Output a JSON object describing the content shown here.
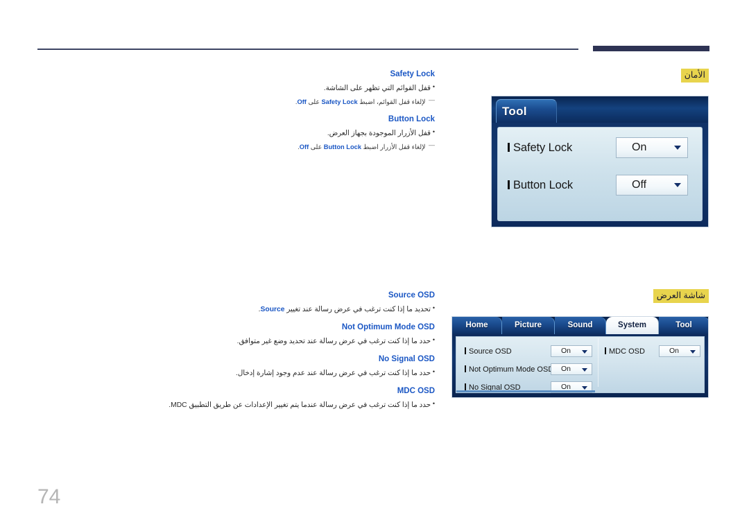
{
  "page": {
    "number": "74"
  },
  "header": {
    "rule_color": "#3c4463",
    "accent_bar_color": "#2e3354"
  },
  "sections": [
    {
      "tag": "الأمان",
      "tag_highlight_color": "#e8d44d",
      "entries": [
        {
          "heading": "Safety Lock",
          "bullet_prefix": "•",
          "bullet": "قفل القوائم التي تظهر على الشاشة.",
          "note_dash": "—",
          "note_ar_before": "لإلغاء قفل القوائم، اضبط",
          "note_en": "Safety Lock",
          "note_ar_mid": "على",
          "note_en_2": "Off",
          "note_ar_after": "."
        },
        {
          "heading": "Button Lock",
          "bullet_prefix": "•",
          "bullet": "قفل الأزرار الموجودة بجهاز العرض.",
          "note_dash": "—",
          "note_ar_before": "لإلغاء قفل الأزرار اضبط",
          "note_en": "Button Lock",
          "note_ar_mid": "على",
          "note_en_2": "Off",
          "note_ar_after": "."
        }
      ]
    },
    {
      "tag": "شاشة العرض",
      "tag_highlight_color": "#e8d44d",
      "entries": [
        {
          "heading": "Source OSD",
          "bullet_prefix": "•",
          "bullet_ar_before": "تحديد ما إذا كنت ترغب في عرض رسالة عند تغيير",
          "bullet_en": "Source",
          "bullet_ar_after": "."
        },
        {
          "heading": "Not Optimum Mode OSD",
          "bullet_prefix": "•",
          "bullet": "حدد ما إذا كنت ترغب في عرض رسالة عند تحديد وضع غير متوافق."
        },
        {
          "heading": "No Signal OSD",
          "bullet_prefix": "•",
          "bullet": "حدد ما إذا كنت ترغب في عرض رسالة عند عدم وجود إشارة إدخال."
        },
        {
          "heading": "MDC OSD",
          "bullet_prefix": "•",
          "bullet_ar_before": "حدد ما إذا كنت ترغب في عرض رسالة عندما يتم تغيير الإعدادات عن طريق التطبيق",
          "bullet_en": "MDC",
          "bullet_ar_after": "."
        }
      ]
    }
  ],
  "osd_tool": {
    "tab_label": "Tool",
    "rows": [
      {
        "label": "Safety Lock",
        "value": "On"
      },
      {
        "label": "Button Lock",
        "value": "Off"
      }
    ]
  },
  "osd_system": {
    "tabs": [
      {
        "label": "Home",
        "active": false
      },
      {
        "label": "Picture",
        "active": false
      },
      {
        "label": "Sound",
        "active": false
      },
      {
        "label": "System",
        "active": true
      },
      {
        "label": "Tool",
        "active": false
      }
    ],
    "left_rows": [
      {
        "label": "Source OSD",
        "value": "On"
      },
      {
        "label": "Not Optimum Mode OSD",
        "value": "On"
      },
      {
        "label": "No Signal OSD",
        "value": "On"
      }
    ],
    "right_rows": [
      {
        "label": "MDC OSD",
        "value": "On"
      }
    ]
  }
}
